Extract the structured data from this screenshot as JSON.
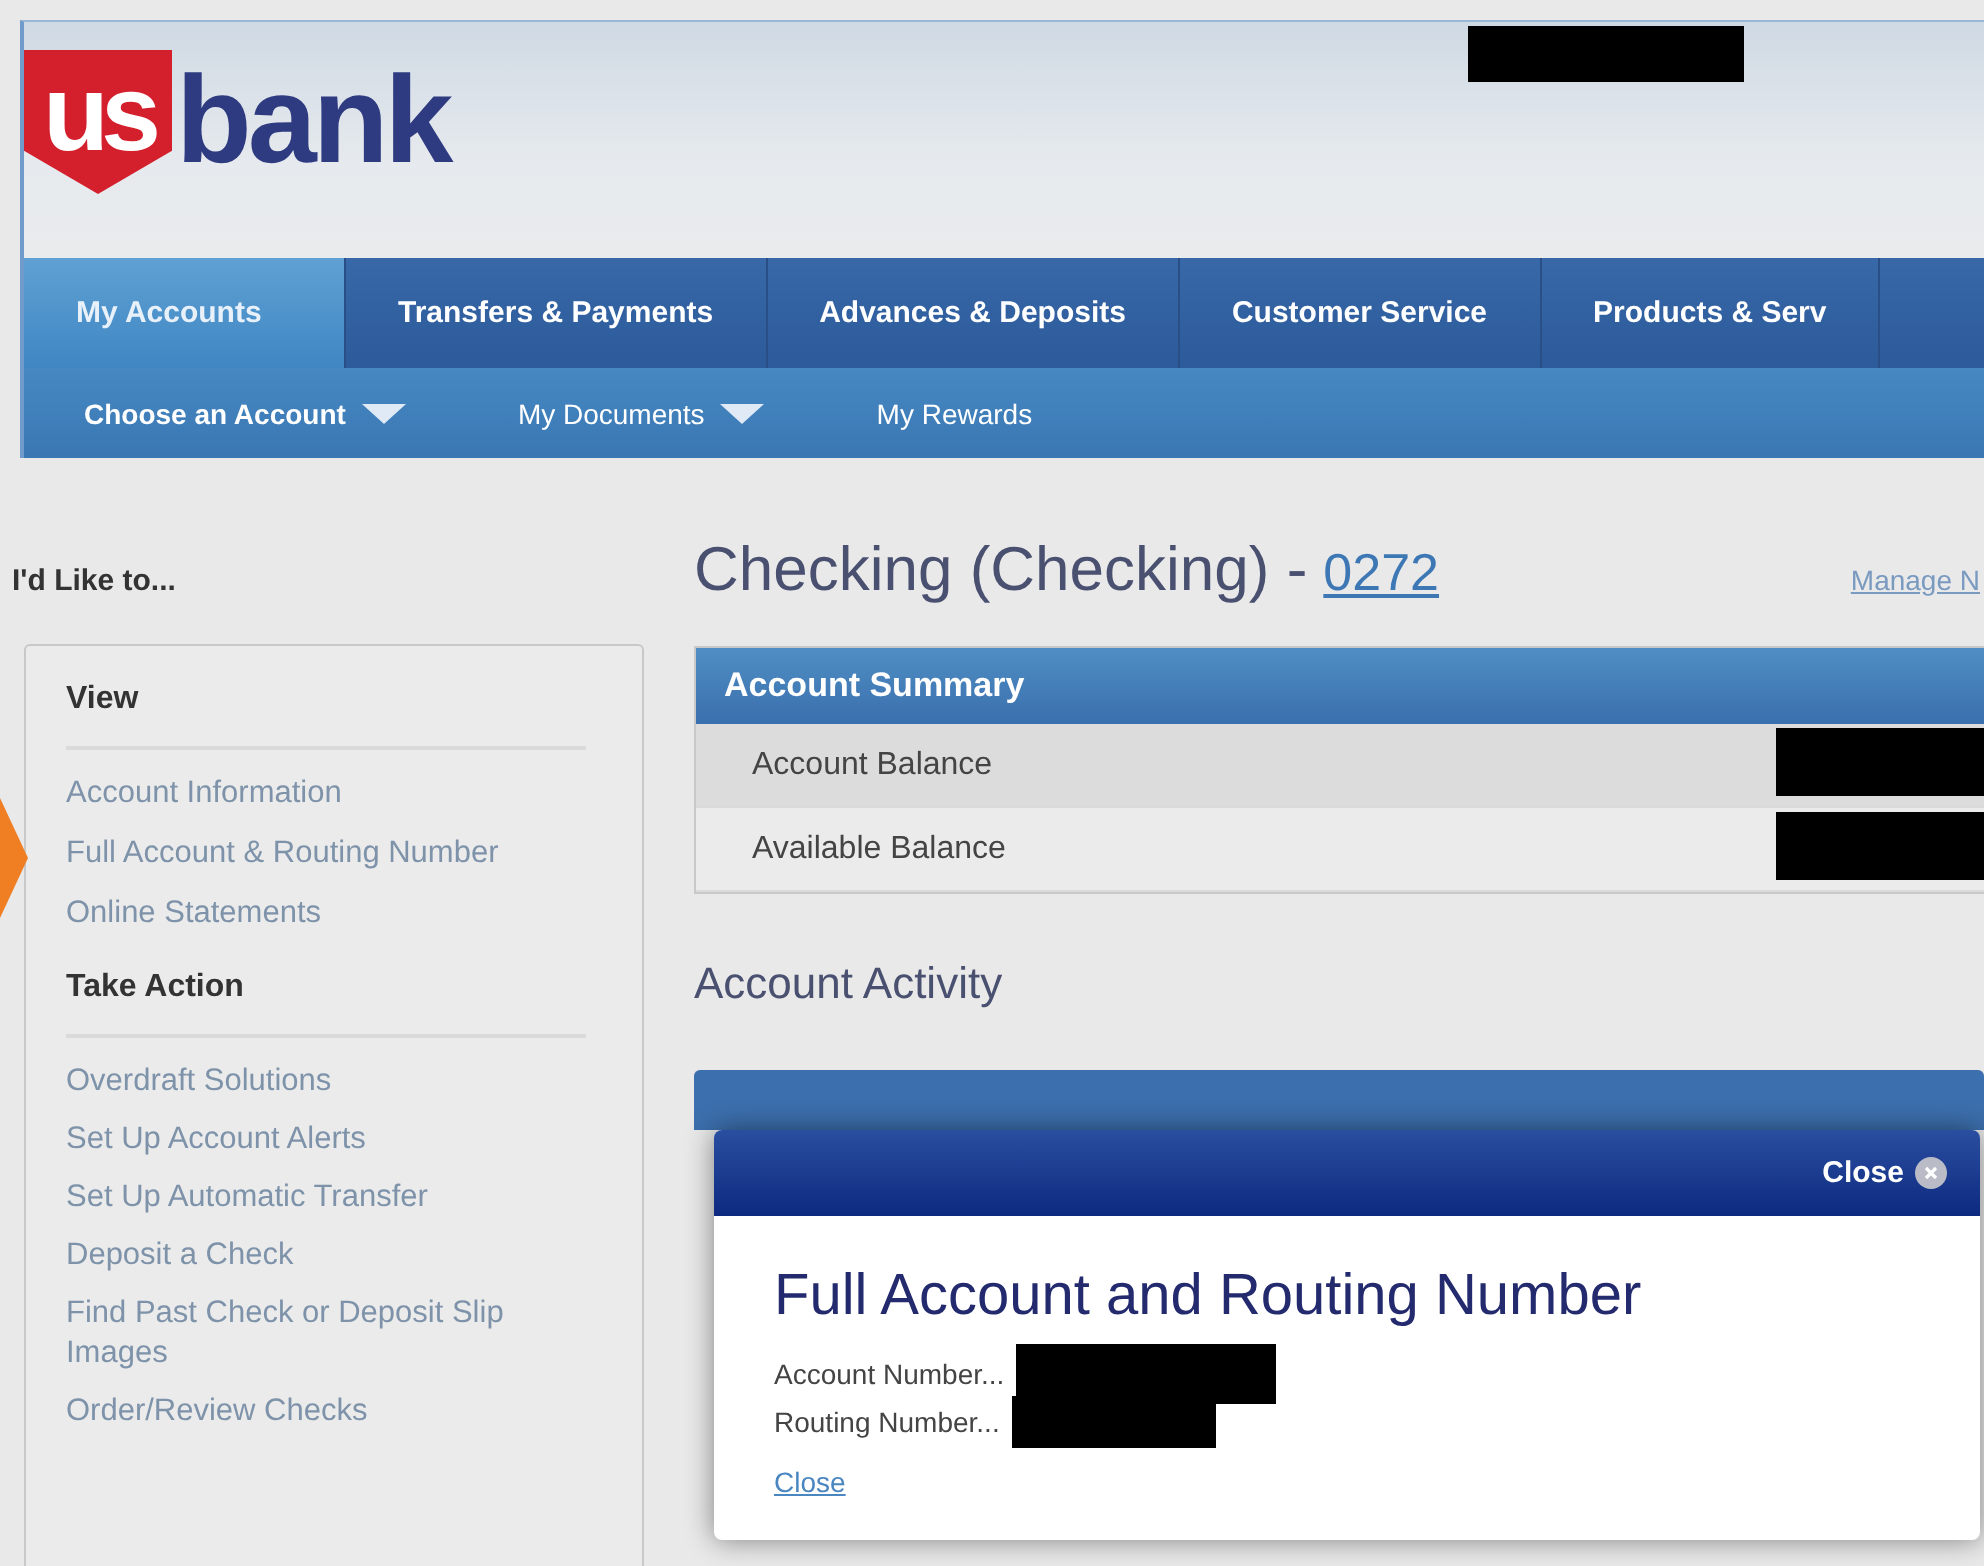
{
  "logo": {
    "mark": "us",
    "word": "bank"
  },
  "nav": {
    "tabs": [
      {
        "label": "My Accounts",
        "selected": true
      },
      {
        "label": "Transfers & Payments",
        "selected": false
      },
      {
        "label": "Advances & Deposits",
        "selected": false
      },
      {
        "label": "Customer Service",
        "selected": false
      },
      {
        "label": "Products & Serv",
        "selected": false
      }
    ],
    "subnav": [
      {
        "label": "Choose an Account",
        "dropdown": true
      },
      {
        "label": "My Documents",
        "dropdown": true
      },
      {
        "label": "My Rewards",
        "dropdown": false
      }
    ]
  },
  "sidebar": {
    "title": "I'd Like to...",
    "sections": [
      {
        "heading": "View",
        "items": [
          {
            "label": "Account Information",
            "pointed": false
          },
          {
            "label": "Full Account & Routing Number",
            "pointed": true
          },
          {
            "label": "Online Statements",
            "pointed": false
          }
        ]
      },
      {
        "heading": "Take Action",
        "items": [
          {
            "label": "Overdraft Solutions",
            "pointed": false
          },
          {
            "label": "Set Up Account Alerts",
            "pointed": false
          },
          {
            "label": "Set Up Automatic Transfer",
            "pointed": false
          },
          {
            "label": "Deposit a Check",
            "pointed": false
          },
          {
            "label": "Find Past Check or Deposit Slip Images",
            "pointed": false
          },
          {
            "label": "Order/Review Checks",
            "pointed": false
          }
        ]
      }
    ]
  },
  "account": {
    "title": "Checking (Checking) -",
    "number": "0272",
    "manage_link": "Manage N"
  },
  "summary": {
    "heading": "Account Summary",
    "rows": [
      {
        "label": "Account Balance"
      },
      {
        "label": "Available Balance"
      }
    ]
  },
  "activity": {
    "title": "Account Activity"
  },
  "modal": {
    "close_button": "Close",
    "title": "Full Account and Routing Number",
    "fields": [
      {
        "label": "Account Number..."
      },
      {
        "label": "Routing Number..."
      }
    ],
    "close_link": "Close"
  }
}
